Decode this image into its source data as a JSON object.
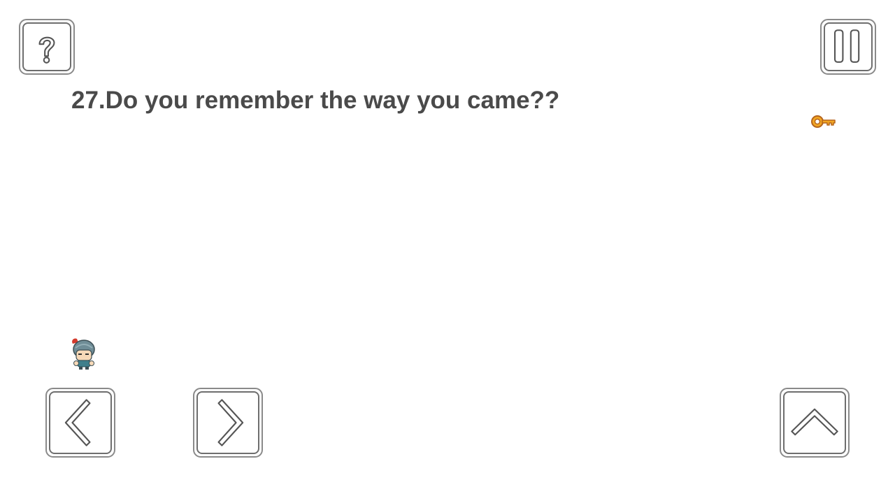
{
  "level": {
    "title": "27.Do you remember the way you came??"
  },
  "controls": {
    "help_icon": "question-mark",
    "pause_icon": "pause-bars",
    "left_icon": "chevron-left",
    "right_icon": "chevron-right",
    "jump_icon": "chevron-up"
  },
  "colors": {
    "background": "#ffffff",
    "text": "#4a4a4a",
    "button_border": "#8a8a8a",
    "key": "#f2a623",
    "key_outline": "#b5651d"
  }
}
